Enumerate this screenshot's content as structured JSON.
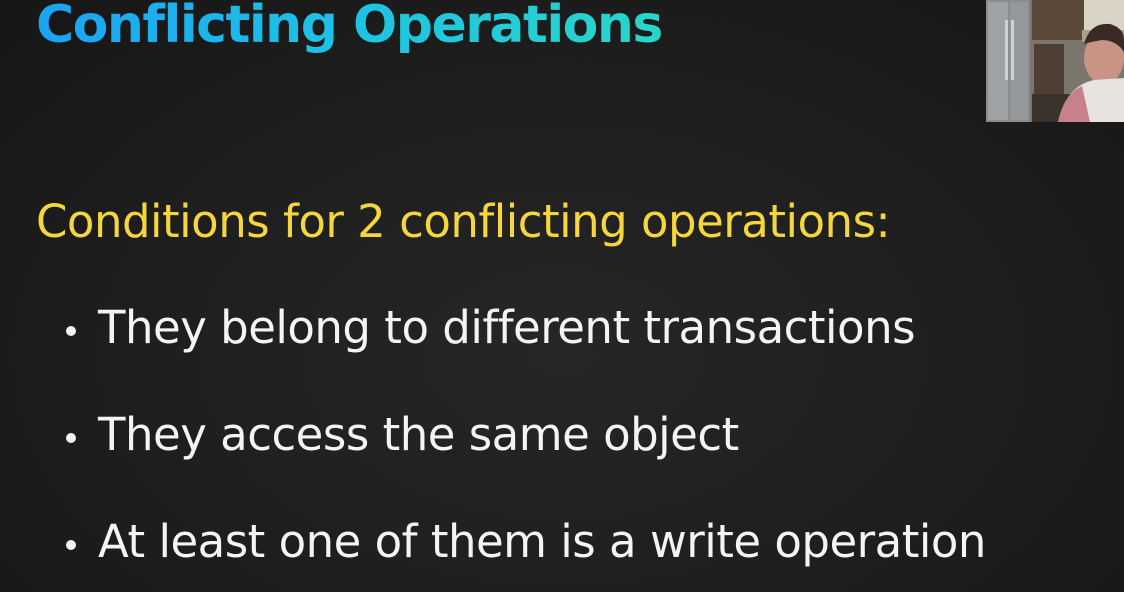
{
  "slide": {
    "title": "Conflicting Operations",
    "subtitle": "Conditions for 2 conflicting operations:",
    "bullets": [
      "They belong to different transactions",
      "They access the same object",
      "At least one of them is a write operation"
    ]
  },
  "colors": {
    "background": "#1e1e1e",
    "title_gradient_start": "#1aa3f2",
    "title_gradient_end": "#28d6c8",
    "subtitle": "#f5d63d",
    "bullet_text": "#f4f4f4"
  },
  "webcam": {
    "icon": "presenter-video-feed"
  }
}
